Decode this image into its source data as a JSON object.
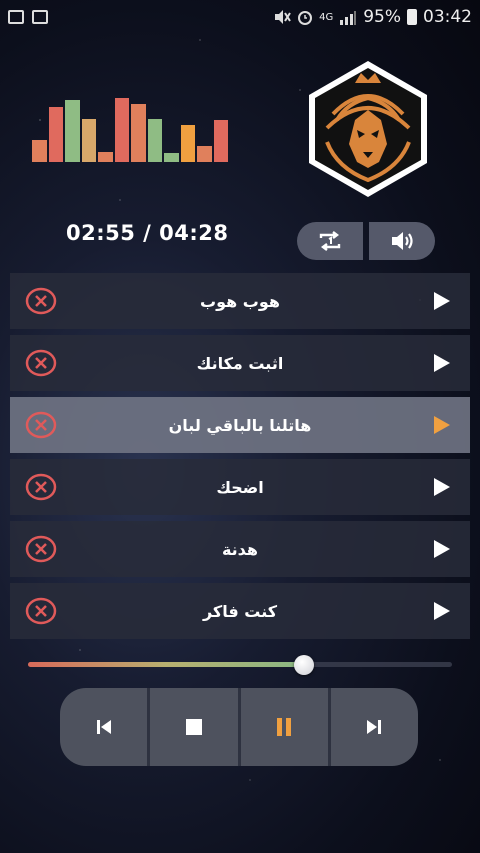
{
  "status_bar": {
    "battery": "95%",
    "time": "03:42",
    "network": "4G"
  },
  "equalizer": {
    "levels": [
      0.33,
      0.83,
      0.94,
      0.65,
      0.15,
      0.97,
      0.88,
      0.65,
      0.13,
      0.56,
      0.25,
      0.64
    ],
    "colors": [
      "#e0805c",
      "#e06a5e",
      "#8fbc84",
      "#d8a86a",
      "#e0805c",
      "#e06a5e",
      "#e0805c",
      "#8fbc84",
      "#8fbc84",
      "#f0a040",
      "#e0805c",
      "#e06a5e"
    ]
  },
  "logo": {
    "icon": "lion-logo-icon",
    "accent": "#d9853b"
  },
  "player": {
    "time_display": "02:55 / 04:28",
    "progress": 0.65
  },
  "toggles": {
    "repeat_icon": "repeat-one-icon",
    "volume_icon": "volume-icon"
  },
  "playlist": [
    {
      "title": "هوب هوب",
      "active": false
    },
    {
      "title": "اثبت مكانك",
      "active": false
    },
    {
      "title": "هاتلنا بالباقي لبان",
      "active": true
    },
    {
      "title": "اضحك",
      "active": false
    },
    {
      "title": "هدنة",
      "active": false
    },
    {
      "title": "كنت فاكر",
      "active": false
    }
  ],
  "controls": [
    "previous-icon",
    "stop-icon",
    "pause-icon",
    "next-icon"
  ],
  "colors": {
    "accent": "#f0a040",
    "delete": "#e05a5a"
  }
}
